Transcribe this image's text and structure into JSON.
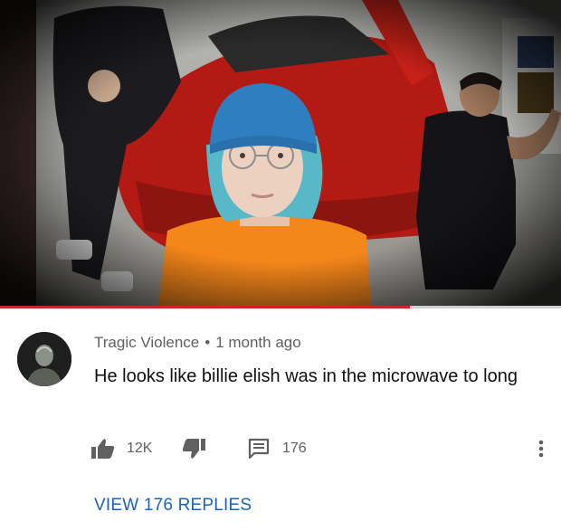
{
  "video": {
    "progress_fraction": 0.73,
    "accent_color": "#d32222"
  },
  "comment": {
    "author": "Tragic Violence",
    "separator": "•",
    "time": "1 month ago",
    "text": "He looks like billie elish was in the microwave to long",
    "like_count": "12K",
    "reply_count": "176",
    "view_replies_label": "VIEW 176 REPLIES"
  },
  "icons": {
    "like": "thumbs-up-icon",
    "dislike": "thumbs-down-icon",
    "reply": "comment-icon",
    "more": "more-vert-icon"
  },
  "colors": {
    "link": "#1565c0",
    "meta_text": "#606060",
    "body_text": "#0f0f0f"
  }
}
